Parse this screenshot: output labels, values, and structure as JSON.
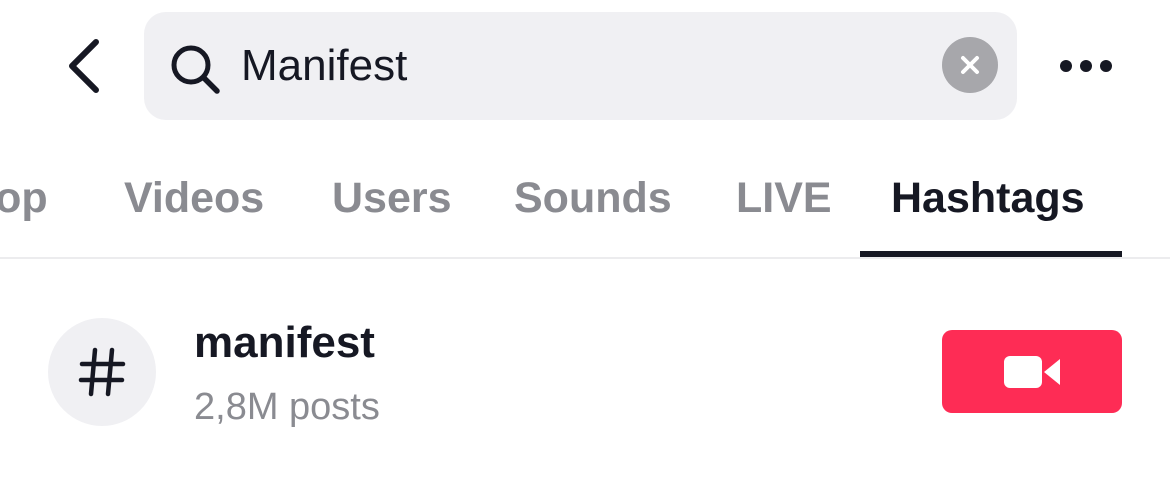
{
  "header": {
    "search": {
      "query": "Manifest",
      "icon": "search-icon"
    },
    "back_icon": "chevron-left-icon",
    "clear_icon": "clear-icon",
    "more_icon": "more-icon"
  },
  "tabs": [
    {
      "label": "Top",
      "active": false
    },
    {
      "label": "Videos",
      "active": false
    },
    {
      "label": "Users",
      "active": false
    },
    {
      "label": "Sounds",
      "active": false
    },
    {
      "label": "LIVE",
      "active": false
    },
    {
      "label": "Hashtags",
      "active": true
    }
  ],
  "results": [
    {
      "icon": "hashtag-icon",
      "title": "manifest",
      "posts": "2,8M posts",
      "action_icon": "video-camera-icon"
    }
  ],
  "colors": {
    "accent": "#fe2c55",
    "text_primary": "#161823",
    "text_secondary": "#8a8b91",
    "search_background": "#f0f0f3"
  }
}
